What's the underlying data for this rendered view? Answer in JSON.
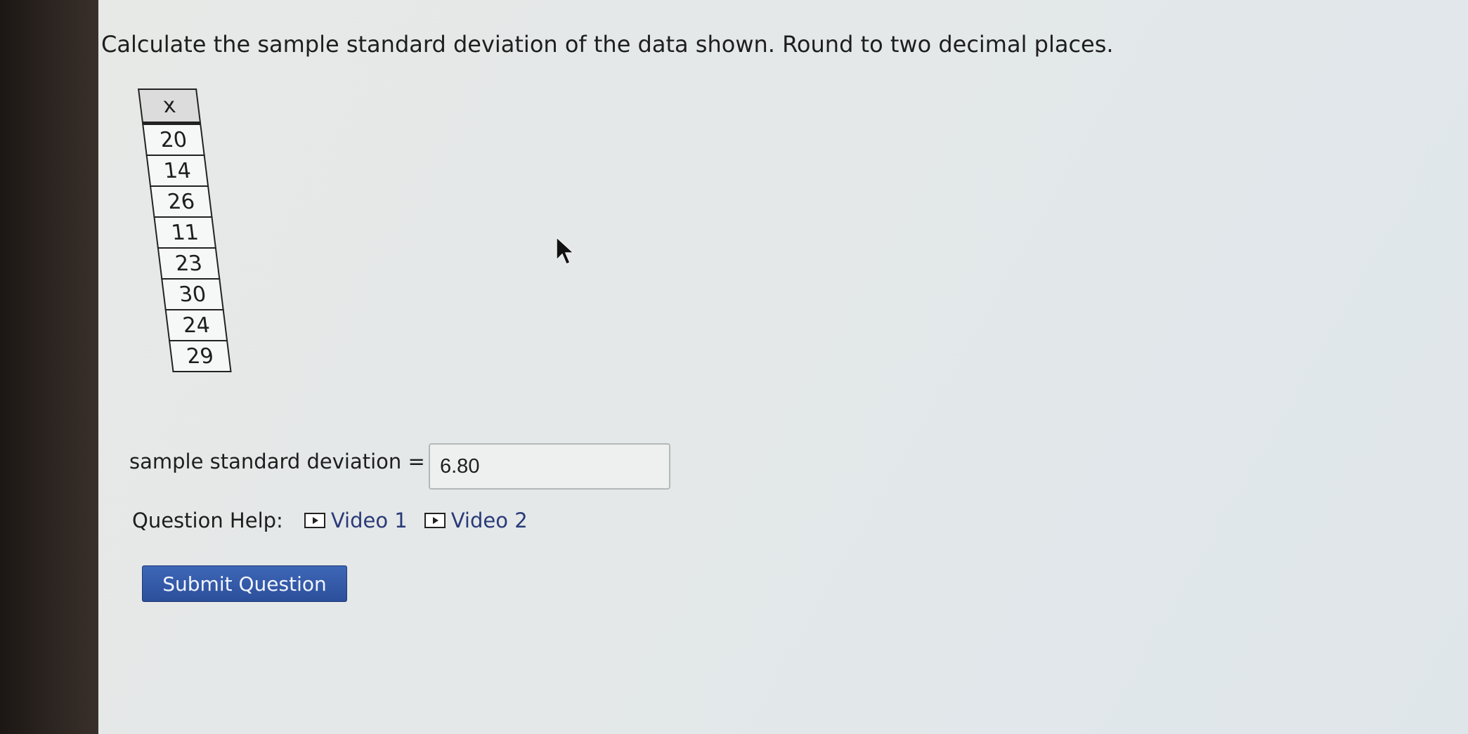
{
  "question": {
    "text": "Calculate the sample standard deviation of the data shown. Round to two decimal places."
  },
  "data_table": {
    "header": "x",
    "values": [
      "20",
      "14",
      "26",
      "11",
      "23",
      "30",
      "24",
      "29"
    ]
  },
  "answer": {
    "label": "sample standard deviation =",
    "value": "6.80"
  },
  "help": {
    "label": "Question Help:",
    "videos": [
      {
        "label": "Video 1",
        "icon": "play-icon"
      },
      {
        "label": "Video 2",
        "icon": "play-icon"
      }
    ]
  },
  "submit": {
    "label": "Submit Question"
  },
  "colors": {
    "link": "#2a3a78",
    "button": "#3557a8"
  }
}
